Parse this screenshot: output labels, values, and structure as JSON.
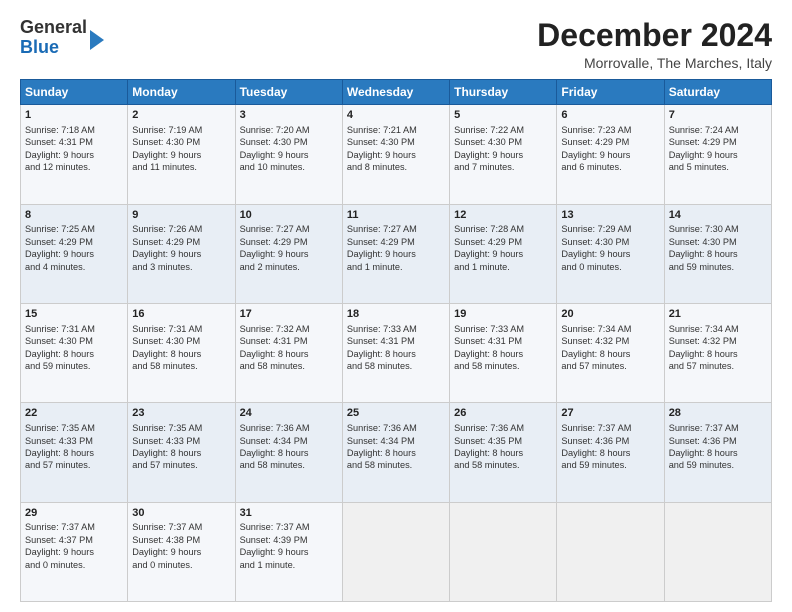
{
  "header": {
    "logo_general": "General",
    "logo_blue": "Blue",
    "month_title": "December 2024",
    "location": "Morrovalle, The Marches, Italy"
  },
  "days_of_week": [
    "Sunday",
    "Monday",
    "Tuesday",
    "Wednesday",
    "Thursday",
    "Friday",
    "Saturday"
  ],
  "weeks": [
    [
      {
        "day": "1",
        "lines": [
          "Sunrise: 7:18 AM",
          "Sunset: 4:31 PM",
          "Daylight: 9 hours",
          "and 12 minutes."
        ]
      },
      {
        "day": "2",
        "lines": [
          "Sunrise: 7:19 AM",
          "Sunset: 4:30 PM",
          "Daylight: 9 hours",
          "and 11 minutes."
        ]
      },
      {
        "day": "3",
        "lines": [
          "Sunrise: 7:20 AM",
          "Sunset: 4:30 PM",
          "Daylight: 9 hours",
          "and 10 minutes."
        ]
      },
      {
        "day": "4",
        "lines": [
          "Sunrise: 7:21 AM",
          "Sunset: 4:30 PM",
          "Daylight: 9 hours",
          "and 8 minutes."
        ]
      },
      {
        "day": "5",
        "lines": [
          "Sunrise: 7:22 AM",
          "Sunset: 4:30 PM",
          "Daylight: 9 hours",
          "and 7 minutes."
        ]
      },
      {
        "day": "6",
        "lines": [
          "Sunrise: 7:23 AM",
          "Sunset: 4:29 PM",
          "Daylight: 9 hours",
          "and 6 minutes."
        ]
      },
      {
        "day": "7",
        "lines": [
          "Sunrise: 7:24 AM",
          "Sunset: 4:29 PM",
          "Daylight: 9 hours",
          "and 5 minutes."
        ]
      }
    ],
    [
      {
        "day": "8",
        "lines": [
          "Sunrise: 7:25 AM",
          "Sunset: 4:29 PM",
          "Daylight: 9 hours",
          "and 4 minutes."
        ]
      },
      {
        "day": "9",
        "lines": [
          "Sunrise: 7:26 AM",
          "Sunset: 4:29 PM",
          "Daylight: 9 hours",
          "and 3 minutes."
        ]
      },
      {
        "day": "10",
        "lines": [
          "Sunrise: 7:27 AM",
          "Sunset: 4:29 PM",
          "Daylight: 9 hours",
          "and 2 minutes."
        ]
      },
      {
        "day": "11",
        "lines": [
          "Sunrise: 7:27 AM",
          "Sunset: 4:29 PM",
          "Daylight: 9 hours",
          "and 1 minute."
        ]
      },
      {
        "day": "12",
        "lines": [
          "Sunrise: 7:28 AM",
          "Sunset: 4:29 PM",
          "Daylight: 9 hours",
          "and 1 minute."
        ]
      },
      {
        "day": "13",
        "lines": [
          "Sunrise: 7:29 AM",
          "Sunset: 4:30 PM",
          "Daylight: 9 hours",
          "and 0 minutes."
        ]
      },
      {
        "day": "14",
        "lines": [
          "Sunrise: 7:30 AM",
          "Sunset: 4:30 PM",
          "Daylight: 8 hours",
          "and 59 minutes."
        ]
      }
    ],
    [
      {
        "day": "15",
        "lines": [
          "Sunrise: 7:31 AM",
          "Sunset: 4:30 PM",
          "Daylight: 8 hours",
          "and 59 minutes."
        ]
      },
      {
        "day": "16",
        "lines": [
          "Sunrise: 7:31 AM",
          "Sunset: 4:30 PM",
          "Daylight: 8 hours",
          "and 58 minutes."
        ]
      },
      {
        "day": "17",
        "lines": [
          "Sunrise: 7:32 AM",
          "Sunset: 4:31 PM",
          "Daylight: 8 hours",
          "and 58 minutes."
        ]
      },
      {
        "day": "18",
        "lines": [
          "Sunrise: 7:33 AM",
          "Sunset: 4:31 PM",
          "Daylight: 8 hours",
          "and 58 minutes."
        ]
      },
      {
        "day": "19",
        "lines": [
          "Sunrise: 7:33 AM",
          "Sunset: 4:31 PM",
          "Daylight: 8 hours",
          "and 58 minutes."
        ]
      },
      {
        "day": "20",
        "lines": [
          "Sunrise: 7:34 AM",
          "Sunset: 4:32 PM",
          "Daylight: 8 hours",
          "and 57 minutes."
        ]
      },
      {
        "day": "21",
        "lines": [
          "Sunrise: 7:34 AM",
          "Sunset: 4:32 PM",
          "Daylight: 8 hours",
          "and 57 minutes."
        ]
      }
    ],
    [
      {
        "day": "22",
        "lines": [
          "Sunrise: 7:35 AM",
          "Sunset: 4:33 PM",
          "Daylight: 8 hours",
          "and 57 minutes."
        ]
      },
      {
        "day": "23",
        "lines": [
          "Sunrise: 7:35 AM",
          "Sunset: 4:33 PM",
          "Daylight: 8 hours",
          "and 57 minutes."
        ]
      },
      {
        "day": "24",
        "lines": [
          "Sunrise: 7:36 AM",
          "Sunset: 4:34 PM",
          "Daylight: 8 hours",
          "and 58 minutes."
        ]
      },
      {
        "day": "25",
        "lines": [
          "Sunrise: 7:36 AM",
          "Sunset: 4:34 PM",
          "Daylight: 8 hours",
          "and 58 minutes."
        ]
      },
      {
        "day": "26",
        "lines": [
          "Sunrise: 7:36 AM",
          "Sunset: 4:35 PM",
          "Daylight: 8 hours",
          "and 58 minutes."
        ]
      },
      {
        "day": "27",
        "lines": [
          "Sunrise: 7:37 AM",
          "Sunset: 4:36 PM",
          "Daylight: 8 hours",
          "and 59 minutes."
        ]
      },
      {
        "day": "28",
        "lines": [
          "Sunrise: 7:37 AM",
          "Sunset: 4:36 PM",
          "Daylight: 8 hours",
          "and 59 minutes."
        ]
      }
    ],
    [
      {
        "day": "29",
        "lines": [
          "Sunrise: 7:37 AM",
          "Sunset: 4:37 PM",
          "Daylight: 9 hours",
          "and 0 minutes."
        ]
      },
      {
        "day": "30",
        "lines": [
          "Sunrise: 7:37 AM",
          "Sunset: 4:38 PM",
          "Daylight: 9 hours",
          "and 0 minutes."
        ]
      },
      {
        "day": "31",
        "lines": [
          "Sunrise: 7:37 AM",
          "Sunset: 4:39 PM",
          "Daylight: 9 hours",
          "and 1 minute."
        ]
      },
      {
        "day": "",
        "lines": []
      },
      {
        "day": "",
        "lines": []
      },
      {
        "day": "",
        "lines": []
      },
      {
        "day": "",
        "lines": []
      }
    ]
  ]
}
